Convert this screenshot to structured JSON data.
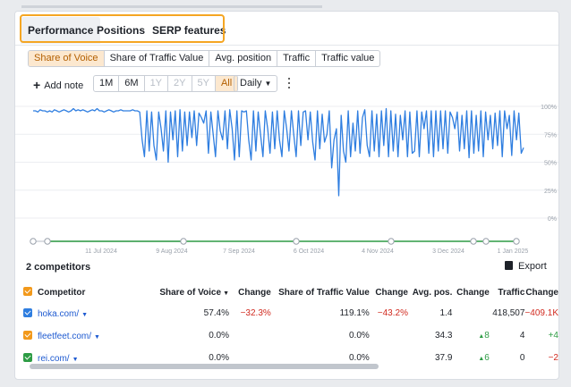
{
  "tabs": [
    {
      "label": "Performance",
      "active": true
    },
    {
      "label": "Positions",
      "active": false
    },
    {
      "label": "SERP features",
      "active": false
    }
  ],
  "metrics": [
    "Share of Voice",
    "Share of Traffic Value",
    "Avg. position",
    "Traffic",
    "Traffic value"
  ],
  "metric_selected": "Share of Voice",
  "toolbar": {
    "add_note": "Add note",
    "ranges": [
      "1M",
      "6M",
      "1Y",
      "2Y",
      "5Y",
      "All"
    ],
    "range_selected": "All",
    "ranges_disabled": [
      "1Y",
      "2Y",
      "5Y"
    ],
    "granularity": "Daily"
  },
  "competitors_section": {
    "title": "2 competitors",
    "export_label": "Export"
  },
  "table": {
    "headers": [
      "Competitor",
      "Share of Voice",
      "Change",
      "Share of Traffic Value",
      "Change",
      "Avg. pos.",
      "Change",
      "Traffic",
      "Change"
    ],
    "rows": [
      {
        "domain": "hoka.com/",
        "color": "#2f7ee0",
        "sov": "57.4%",
        "sov_change": "−32.3%",
        "stv": "119.1%",
        "stv_change": "−43.2%",
        "avg_pos": "1.4",
        "pos_change": "",
        "traffic": "418,507",
        "traffic_change": "−409.1K"
      },
      {
        "domain": "fleetfeet.com/",
        "color": "#f2991b",
        "sov": "0.0%",
        "sov_change": "",
        "stv": "0.0%",
        "stv_change": "",
        "avg_pos": "34.3",
        "pos_change": "8",
        "traffic": "4",
        "traffic_change": "+4"
      },
      {
        "domain": "rei.com/",
        "color": "#2e9c45",
        "sov": "0.0%",
        "sov_change": "",
        "stv": "0.0%",
        "stv_change": "",
        "avg_pos": "37.9",
        "pos_change": "6",
        "traffic": "0",
        "traffic_change": "−2"
      }
    ]
  },
  "chart_data": {
    "type": "line",
    "ylim": [
      0,
      100
    ],
    "y_ticks": [
      "100%",
      "75%",
      "50%",
      "25%",
      "0%"
    ],
    "x_ticks": [
      "11 Jul 2024",
      "9 Aug 2024",
      "7 Sep 2024",
      "6 Oct 2024",
      "4 Nov 2024",
      "3 Dec 2024",
      "1 Jan 2025"
    ],
    "grid": true,
    "line_color": "#2f7ee0",
    "series": [
      {
        "values": [
          96,
          96,
          95,
          97,
          96,
          96,
          95,
          96,
          95,
          97,
          96,
          95,
          96,
          97,
          96,
          95,
          96,
          98,
          96,
          97,
          96,
          97,
          96,
          95,
          96,
          97,
          96,
          98,
          96,
          96,
          95,
          96,
          97,
          96,
          95,
          96,
          96,
          97,
          96,
          96,
          96,
          96,
          97,
          96,
          96,
          95,
          70,
          55,
          96,
          60,
          95,
          65,
          52,
          95,
          80,
          60,
          96,
          50,
          95,
          70,
          96,
          55,
          97,
          60,
          95,
          65,
          95,
          72,
          96,
          65,
          94,
          90,
          85,
          96,
          58,
          95,
          75,
          55,
          96,
          78,
          70,
          96,
          62,
          97,
          80,
          52,
          96,
          55,
          96,
          95,
          96,
          70,
          52,
          96,
          60,
          95,
          75,
          55,
          96,
          80,
          58,
          95,
          62,
          96,
          70,
          55,
          96,
          80,
          60,
          96,
          75,
          55,
          96,
          65,
          95,
          96,
          70,
          95,
          68,
          52,
          96,
          62,
          93,
          68,
          75,
          96,
          45,
          70,
          80,
          20,
          92,
          60,
          50,
          96,
          55,
          85,
          60,
          96,
          58,
          90,
          97,
          65,
          55,
          96,
          60,
          93,
          55,
          96,
          65,
          98,
          55,
          96,
          60,
          93,
          55,
          92,
          70,
          96,
          55,
          95,
          58,
          60,
          96,
          55,
          95,
          80,
          96,
          58,
          96,
          55,
          96,
          60,
          96,
          62,
          96,
          58,
          95,
          90,
          80,
          95,
          60,
          92,
          62,
          96,
          54,
          96,
          58,
          92,
          60,
          96,
          55,
          95,
          70,
          92,
          62,
          94,
          65,
          96,
          55,
          96,
          80,
          92,
          56,
          96,
          70,
          94,
          58,
          63
        ],
        "start_date": "2024-06-25"
      }
    ]
  }
}
